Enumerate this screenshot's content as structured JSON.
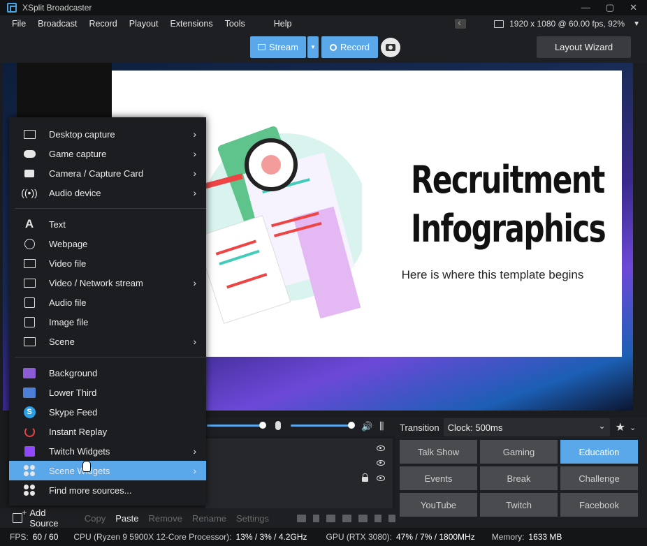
{
  "window": {
    "title": "XSplit Broadcaster"
  },
  "menu": [
    "File",
    "Broadcast",
    "Record",
    "Playout",
    "Extensions",
    "Tools",
    "Help"
  ],
  "resolution": "1920 x 1080 @ 60.00 fps, 92%",
  "toolbar": {
    "stream": "Stream",
    "record": "Record",
    "layout_wizard": "Layout Wizard"
  },
  "slide": {
    "title_line1": "Recruitment",
    "title_line2": "Infographics",
    "subtitle": "Here is where this template begins"
  },
  "context_menu": {
    "group1": [
      {
        "label": "Desktop capture",
        "icon": "monitor-icon",
        "submenu": true
      },
      {
        "label": "Game capture",
        "icon": "gamepad-icon",
        "submenu": true
      },
      {
        "label": "Camera / Capture Card",
        "icon": "camera-icon",
        "submenu": true
      },
      {
        "label": "Audio device",
        "icon": "broadcast-icon",
        "submenu": true
      }
    ],
    "group2": [
      {
        "label": "Text",
        "icon": "text-icon",
        "submenu": false
      },
      {
        "label": "Webpage",
        "icon": "globe-icon",
        "submenu": false
      },
      {
        "label": "Video file",
        "icon": "video-file-icon",
        "submenu": false
      },
      {
        "label": "Video / Network stream",
        "icon": "stream-icon",
        "submenu": true
      },
      {
        "label": "Audio file",
        "icon": "audio-file-icon",
        "submenu": false
      },
      {
        "label": "Image file",
        "icon": "image-file-icon",
        "submenu": false
      },
      {
        "label": "Scene",
        "icon": "scene-icon",
        "submenu": true
      }
    ],
    "group3": [
      {
        "label": "Background",
        "icon": "background-icon",
        "submenu": false
      },
      {
        "label": "Lower Third",
        "icon": "lower-third-icon",
        "submenu": false
      },
      {
        "label": "Skype Feed",
        "icon": "skype-icon",
        "submenu": false
      },
      {
        "label": "Instant Replay",
        "icon": "replay-icon",
        "submenu": false
      },
      {
        "label": "Twitch Widgets",
        "icon": "twitch-icon",
        "submenu": true
      },
      {
        "label": "Scene Widgets",
        "icon": "widgets-icon",
        "submenu": true,
        "highlighted": true
      },
      {
        "label": "Find more sources...",
        "icon": "more-sources-icon",
        "submenu": false
      }
    ]
  },
  "transition": {
    "label": "Transition",
    "value": "Clock: 500ms"
  },
  "scenes": [
    "Talk Show",
    "Gaming",
    "Education",
    "Events",
    "Break",
    "Challenge",
    "YouTube",
    "Twitch",
    "Facebook"
  ],
  "active_scene": "Education",
  "actions": {
    "add_source": "Add Source",
    "copy": "Copy",
    "paste": "Paste",
    "remove": "Remove",
    "rename": "Rename",
    "settings": "Settings"
  },
  "status": {
    "fps_label": "FPS:",
    "fps_value": "60 / 60",
    "cpu_label": "CPU (Ryzen 9 5900X 12-Core Processor):",
    "cpu_value": "13% / 3% / 4.2GHz",
    "gpu_label": "GPU (RTX 3080):",
    "gpu_value": "47% / 7% / 1800MHz",
    "mem_label": "Memory:",
    "mem_value": "1633 MB"
  },
  "colors": {
    "accent": "#5aa8ea",
    "background": "#1e1f22"
  }
}
